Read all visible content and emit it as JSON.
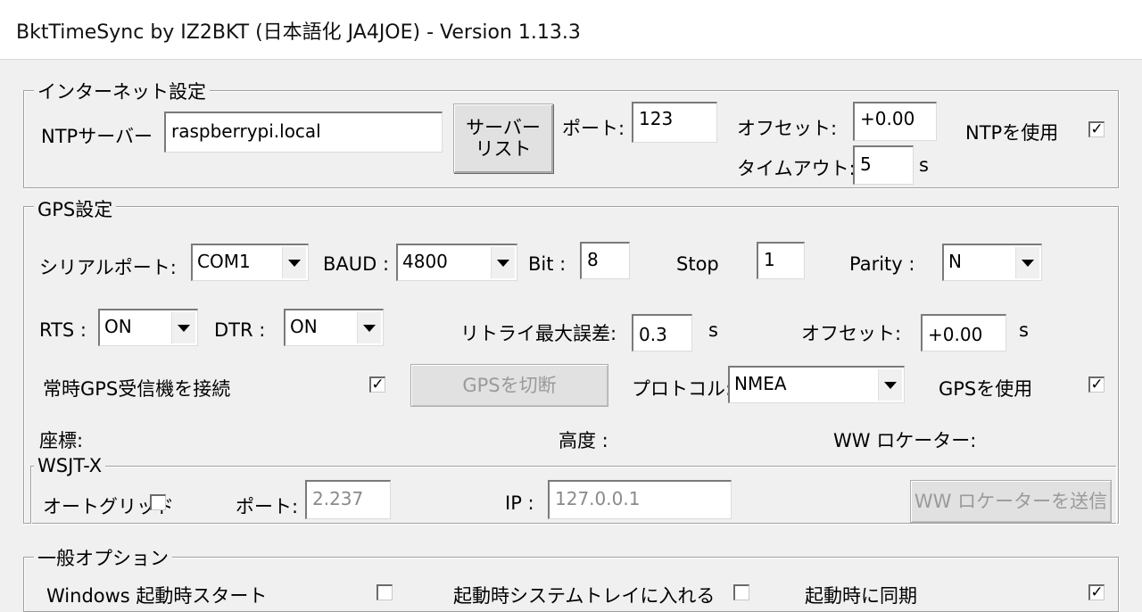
{
  "window": {
    "title": "BktTimeSync by IZ2BKT (日本語化 JA4JOE) - Version 1.13.3"
  },
  "internet": {
    "legend": "インターネット設定",
    "ntp_server_label": "NTPサーバー",
    "ntp_server_value": "raspberrypi.local",
    "server_list_button_line1": "サーバー",
    "server_list_button_line2": "リスト",
    "port_label": "ポート:",
    "port_value": "123",
    "offset_label": "オフセット:",
    "offset_value": "+0.00",
    "timeout_label": "タイムアウト:",
    "timeout_value": "5",
    "timeout_unit": "s",
    "use_ntp_label": "NTPを使用",
    "use_ntp_checked": "✓"
  },
  "gps": {
    "legend": "GPS設定",
    "serial_port_label": "シリアルポート:",
    "serial_port_value": "COM1",
    "baud_label": "BAUD :",
    "baud_value": "4800",
    "bit_label": "Bit :",
    "bit_value": "8",
    "stop_label": "Stop",
    "stop_value": "1",
    "parity_label": "Parity :",
    "parity_value": "N",
    "rts_label": "RTS :",
    "rts_value": "ON",
    "dtr_label": "DTR :",
    "dtr_value": "ON",
    "retry_label": "リトライ最大誤差:",
    "retry_value": "0.3",
    "retry_unit": "s",
    "offset_label": "オフセット:",
    "offset_value": "+0.00",
    "offset_unit": "s",
    "always_connect_label": "常時GPS受信機を接続",
    "always_connect_checked": "✓",
    "disconnect_button": "GPSを切断",
    "protocol_label": "プロトコル:",
    "protocol_value": "NMEA",
    "use_gps_label": "GPSを使用",
    "use_gps_checked": "✓",
    "coords_label": "座標:",
    "altitude_label": "高度 :",
    "ww_locator_label": "WW ロケーター:"
  },
  "wsjtx": {
    "legend": "WSJT-X",
    "autogrid_label": "オートグリッド",
    "port_label": "ポート:",
    "port_value": "2.237",
    "ip_label": "IP :",
    "ip_value": "127.0.0.1",
    "send_locator_button": "WW ロケーターを送信"
  },
  "general": {
    "legend": "一般オプション",
    "windows_start_label": "Windows 起動時スタート",
    "tray_label": "起動時システムトレイに入れる",
    "sync_on_start_label": "起動時に同期",
    "sync_on_start_checked": "✓"
  }
}
